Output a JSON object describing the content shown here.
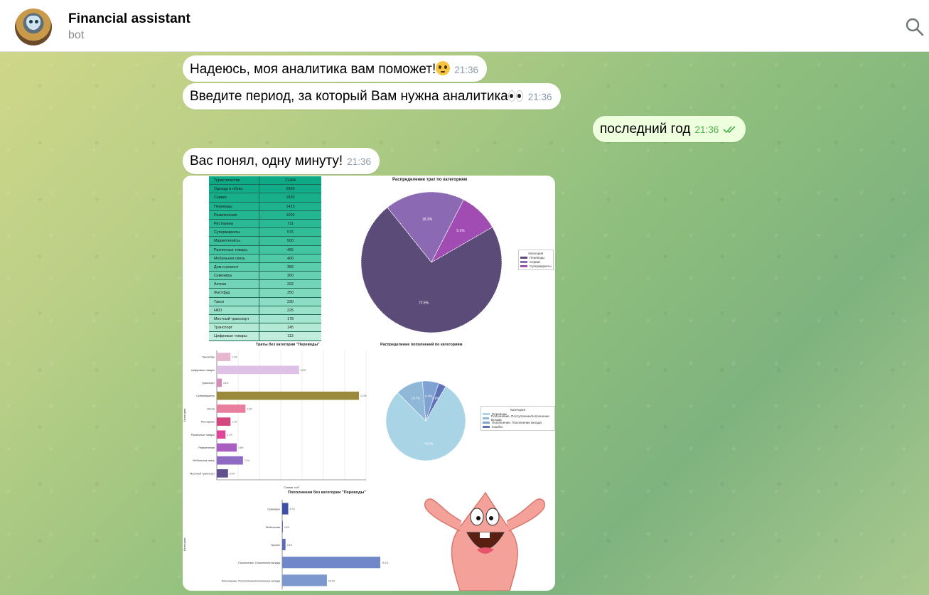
{
  "header": {
    "title": "Financial assistant",
    "subtitle": "bot",
    "search_icon": "search-icon"
  },
  "messages": [
    {
      "dir": "in",
      "text": "Надеюсь, моя аналитика вам поможет!",
      "emoji": "pleading-face-emoji",
      "time": "21:36"
    },
    {
      "dir": "in",
      "text": "Введите период, за который Вам нужна аналитика",
      "emoji": "eyes-emoji",
      "time": "21:36"
    },
    {
      "dir": "out",
      "text": "последний год",
      "time": "21:36",
      "status": "read-double-check-icon"
    },
    {
      "dir": "in",
      "text": "Вас понял, одну минуту!",
      "time": "21:36"
    }
  ],
  "table": {
    "rows": [
      [
        "Туристичестве",
        "21484"
      ],
      [
        "Одежда и обувь",
        "2820"
      ],
      [
        "Сервис",
        "1820"
      ],
      [
        "Переводы",
        "1415"
      ],
      [
        "Развлечения",
        "1020"
      ],
      [
        "Рестораны",
        "711"
      ],
      [
        "Супермаркеты",
        "576"
      ],
      [
        "Маркетплейсы",
        "500"
      ],
      [
        "Различные товары",
        "455"
      ],
      [
        "Мобильная связь",
        "400"
      ],
      [
        "Дом и ремонт",
        "356"
      ],
      [
        "Сувениры",
        "300"
      ],
      [
        "Аптеки",
        "292"
      ],
      [
        "Фастфуд",
        "250"
      ],
      [
        "Такси",
        "230"
      ],
      [
        "НКО",
        "225"
      ],
      [
        "Местный транспорт",
        "178"
      ],
      [
        "Транспорт",
        "145"
      ],
      [
        "Цифровые товары",
        "113"
      ]
    ],
    "colors": [
      "#0eaa86",
      "#12ad88",
      "#17b08b",
      "#1db38e",
      "#23b691",
      "#29b994",
      "#31bd98",
      "#3ac19c",
      "#44c5a1",
      "#4fc9a6",
      "#5acdab",
      "#66d1b1",
      "#72d5b7",
      "#7fd9bd",
      "#8cddc3",
      "#99e1c9",
      "#a6e5d0",
      "#b4e9d6",
      "#c1eddc"
    ]
  },
  "chart_data": [
    {
      "type": "pie",
      "title": "Распределение трат по категориям",
      "labels": [
        "Переводы",
        "Сервис",
        "Супермаркеты"
      ],
      "values": [
        72.5,
        18.3,
        9.1
      ],
      "value_labels": [
        "72.5%",
        "18.3%",
        "9.1%"
      ],
      "colors": [
        "#5b4b78",
        "#8b6ab3",
        "#a04cb3"
      ],
      "legend_title": "Категория",
      "legend_position": "right"
    },
    {
      "type": "bar",
      "title": "Траты без категории \"Переводы\"",
      "xlabel": "Сумма, руб",
      "ylabel": "Категория",
      "categories": [
        "Такси/Ярн",
        "Цифровые товары",
        "Транспорт",
        "Супермаркеты",
        "Отели",
        "Рестораны",
        "Различные товары",
        "Развлечения",
        "Мобильная связь",
        "Местный транспорт"
      ],
      "values": [
        1.1,
        6.6,
        0.4,
        11.4,
        2.3,
        1.1,
        0.7,
        1.6,
        2.1,
        0.9
      ],
      "colors": [
        "#e7b6cf",
        "#dfc0e6",
        "#d38cbc",
        "#9b8a3b",
        "#e97f9e",
        "#d4467e",
        "#e0459a",
        "#a85fbf",
        "#8e6ac2",
        "#63508f"
      ],
      "grid": true
    },
    {
      "type": "pie",
      "title": "Распределение пополнений по категориям",
      "labels": [
        "Переводы",
        "Пополнение. Поступление/пополнение вклада",
        "Пополнение. Пополнение вклада",
        "Кэшбэк"
      ],
      "values": [
        76.0,
        10.7,
        6.4,
        2.9
      ],
      "value_labels": [
        "76.0%",
        "10.7%",
        "6.4%",
        "2.9%"
      ],
      "colors": [
        "#a9d4e6",
        "#8fb7d8",
        "#7fa2d2",
        "#5d72b7"
      ],
      "legend_title": "Категория",
      "legend_position": "right"
    },
    {
      "type": "bar",
      "title": "Пополнения без категории \"Переводы\"",
      "ylabel": "Категория",
      "categories": [
        "Сувениры",
        "Мобильная",
        "Прочее",
        "Пополнение. Пополнение вклада",
        "Пополнение. Поступление/пополнение вклада"
      ],
      "values": [
        4.7,
        0.5,
        2.6,
        76.1,
        34.7
      ],
      "colors": [
        "#3e4fa8",
        "#4b5bb0",
        "#5d6cb8",
        "#7088c8",
        "#7d97cf"
      ]
    }
  ],
  "sticker": "patrick-star-sticker"
}
